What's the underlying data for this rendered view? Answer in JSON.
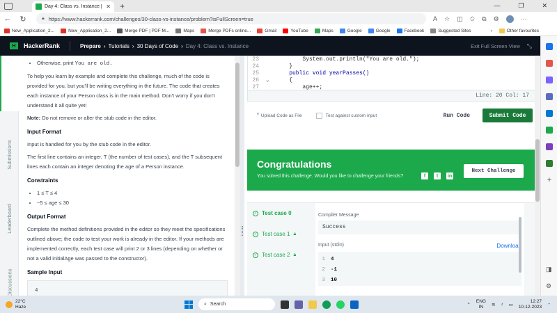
{
  "browser": {
    "tab_title": "Day 4: Class vs. Instance | HackerRank",
    "url": "https://www.hackerrank.com/challenges/30-class-vs-instance/problem?isFullScreen=true",
    "bookmarks": [
      "New_Application_2...",
      "New_Application_2...",
      "Merge PDF | PDF M...",
      "Maps",
      "Merge PDFs online...",
      "Gmail",
      "YouTube",
      "Maps",
      "Google",
      "Google",
      "Facebook",
      "Suggested Sites"
    ],
    "other_favourites": "Other favourites"
  },
  "hrnav": {
    "brand": "HackerRank",
    "crumbs": [
      "Prepare",
      "Tutorials",
      "30 Days of Code",
      "Day 4: Class vs. Instance"
    ],
    "exit_fullscreen": "Exit Full Screen View"
  },
  "vtabs": [
    "Problem",
    "Submissions",
    "Leaderboard",
    "Discussions"
  ],
  "problem": {
    "bullet_otherwise_prefix": "Otherwise, print",
    "bullet_otherwise_code": "You are old.",
    "para1": "To help you learn by example and complete this challenge, much of the code is provided for you, but you'll be writing everything in the future. The code that creates each instance of your Person class is in the main method. Don't worry if you don't understand it all quite yet!",
    "note_label": "Note:",
    "note_text": "Do not remove or alter the stub code in the editor.",
    "input_format_title": "Input Format",
    "input_format_p1": "Input is handled for you by the stub code in the editor.",
    "input_format_p2": "The first line contains an integer, T (the number of test cases), and the T subsequent lines each contain an integer denoting the age of a Person instance.",
    "constraints_title": "Constraints",
    "constraints": [
      "1 ≤ T ≤ 4",
      "−5 ≤ age ≤ 30"
    ],
    "output_format_title": "Output Format",
    "output_format_p": "Complete the method definitions provided in the editor so they meet the specifications outlined above; the code to test your work is already in the editor. If your methods are implemented correctly, each test case will print 2 or 3 lines (depending on whether or not a valid initialAge was passed to the constructor).",
    "sample_input_title": "Sample Input",
    "sample_input_first": "4"
  },
  "editor": {
    "lines": [
      {
        "n": "23",
        "code": "        System.out.println(\"You are old.\");"
      },
      {
        "n": "24",
        "code": "    }"
      },
      {
        "n": "25",
        "code": "    public void yearPasses()"
      },
      {
        "n": "26",
        "code": "    {"
      },
      {
        "n": "27",
        "code": "        age++;"
      }
    ],
    "status": "Line: 20 Col: 17"
  },
  "actions": {
    "upload": "Upload Code as File",
    "custom_input": "Test against custom input",
    "run": "Run Code",
    "submit": "Submit Code"
  },
  "congrats": {
    "title": "Congratulations",
    "subtitle": "You solved this challenge. Would you like to challenge your friends?",
    "next": "Next Challenge"
  },
  "tests": {
    "cases": [
      "Test case 0",
      "Test case 1",
      "Test case 2"
    ],
    "compiler_label": "Compiler Message",
    "compiler_message": "Success",
    "stdin_label": "Input (stdin)",
    "download": "Download",
    "stdin": [
      {
        "n": "1",
        "v": "4"
      },
      {
        "n": "2",
        "v": "-1"
      },
      {
        "n": "3",
        "v": "10"
      }
    ]
  },
  "taskbar": {
    "temp": "22°C",
    "weather": "Haze",
    "search": "Search",
    "lang1": "ENG",
    "lang2": "IN",
    "time": "12:27",
    "date": "10-12-2023"
  },
  "colors": {
    "accent": "#1ba94c",
    "nav_bg": "#0e141e",
    "submit": "#1a7a3a"
  }
}
